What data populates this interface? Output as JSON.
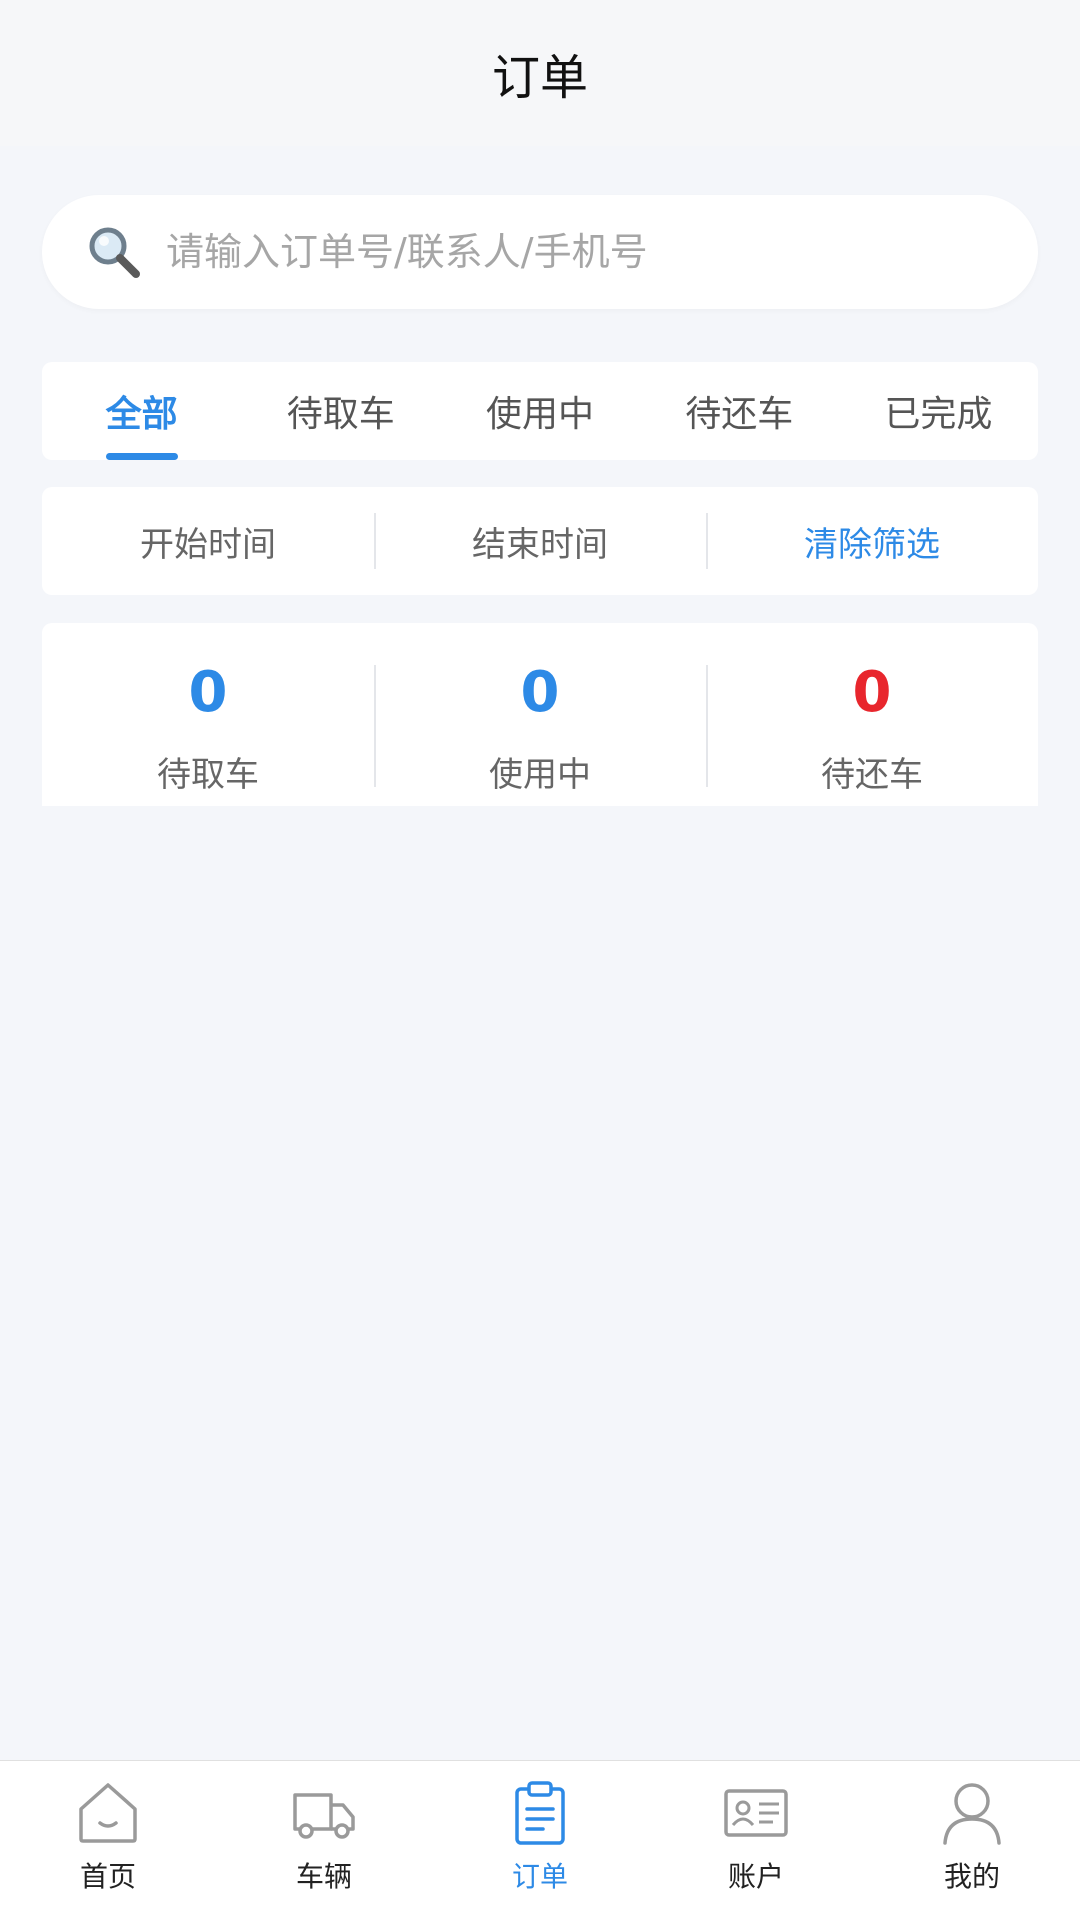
{
  "header": {
    "title": "订单"
  },
  "search": {
    "placeholder": "请输入订单号/联系人/手机号"
  },
  "tabs": [
    {
      "label": "全部",
      "active": true
    },
    {
      "label": "待取车"
    },
    {
      "label": "使用中"
    },
    {
      "label": "待还车"
    },
    {
      "label": "已完成"
    }
  ],
  "filter": {
    "start_label": "开始时间",
    "end_label": "结束时间",
    "clear_label": "清除筛选"
  },
  "stats": [
    {
      "value": "0",
      "label": "待取车",
      "color": "#2d8ae6"
    },
    {
      "value": "0",
      "label": "使用中",
      "color": "#2d8ae6"
    },
    {
      "value": "0",
      "label": "待还车",
      "color": "#e8262d"
    }
  ],
  "tabbar": [
    {
      "label": "首页",
      "icon": "home-icon"
    },
    {
      "label": "车辆",
      "icon": "truck-icon"
    },
    {
      "label": "订单",
      "icon": "clipboard-icon",
      "active": true
    },
    {
      "label": "账户",
      "icon": "id-card-icon"
    },
    {
      "label": "我的",
      "icon": "user-icon"
    }
  ],
  "colors": {
    "accent": "#2d8ae6",
    "alert": "#e8262d",
    "background": "#f4f6fa"
  }
}
